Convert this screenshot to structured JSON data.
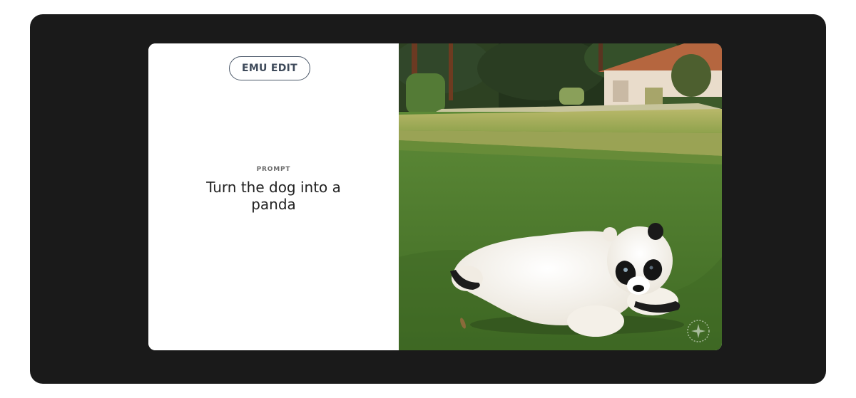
{
  "badge": {
    "label": "EMU EDIT"
  },
  "prompt": {
    "label": "PROMPT",
    "text": "Turn the dog into a panda"
  },
  "image": {
    "subject": "panda-on-lawn",
    "icons": [
      "sparkle-icon"
    ]
  },
  "colors": {
    "frame": "#1a1a1a",
    "badge_border": "#4a5768",
    "text": "#222222",
    "grass": "#4f7a2e"
  }
}
